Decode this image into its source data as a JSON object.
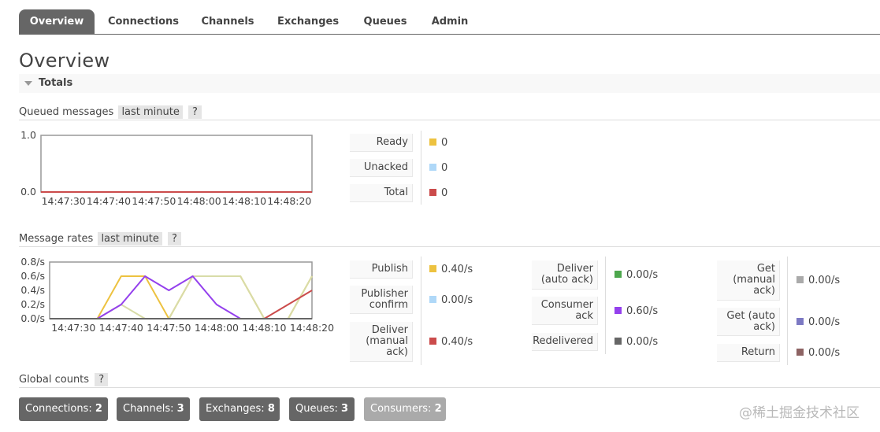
{
  "tabs": [
    "Overview",
    "Connections",
    "Channels",
    "Exchanges",
    "Queues",
    "Admin"
  ],
  "page_title": "Overview",
  "section": {
    "title": "Totals"
  },
  "queued": {
    "heading": "Queued messages",
    "range": "last minute",
    "help": "?",
    "legend": [
      {
        "label": "Ready",
        "value": "0",
        "color": "#edc240"
      },
      {
        "label": "Unacked",
        "value": "0",
        "color": "#afd8f8"
      },
      {
        "label": "Total",
        "value": "0",
        "color": "#cb4b4b"
      }
    ]
  },
  "rates": {
    "heading": "Message rates",
    "range": "last minute",
    "help": "?",
    "legend_col1": [
      {
        "label": "Publish",
        "value": "0.40/s",
        "color": "#edc240"
      },
      {
        "label": "Publisher confirm",
        "value": "0.00/s",
        "color": "#afd8f8"
      },
      {
        "label": "Deliver (manual ack)",
        "value": "0.40/s",
        "color": "#cb4b4b"
      }
    ],
    "legend_col2": [
      {
        "label": "Deliver (auto ack)",
        "value": "0.00/s",
        "color": "#4da74d"
      },
      {
        "label": "Consumer ack",
        "value": "0.60/s",
        "color": "#9440ed"
      },
      {
        "label": "Redelivered",
        "value": "0.00/s",
        "color": "#666666"
      }
    ],
    "legend_col3": [
      {
        "label": "Get (manual ack)",
        "value": "0.00/s",
        "color": "#aaaaaa"
      },
      {
        "label": "Get (auto ack)",
        "value": "0.00/s",
        "color": "#7c79c3"
      },
      {
        "label": "Return",
        "value": "0.00/s",
        "color": "#8d6363"
      }
    ]
  },
  "global": {
    "heading": "Global counts",
    "help": "?",
    "counts": [
      {
        "label": "Connections:",
        "value": "2"
      },
      {
        "label": "Channels:",
        "value": "3"
      },
      {
        "label": "Exchanges:",
        "value": "8"
      },
      {
        "label": "Queues:",
        "value": "3"
      },
      {
        "label": "Consumers:",
        "value": "2"
      }
    ]
  },
  "watermark": "@稀土掘金技术社区",
  "chart_data": [
    {
      "type": "line",
      "name": "queued-messages",
      "x": [
        "14:47:30",
        "14:47:40",
        "14:47:50",
        "14:48:00",
        "14:48:10",
        "14:48:20"
      ],
      "yticks": [
        "1.0",
        "0.0"
      ],
      "ylim": [
        0,
        1
      ],
      "series": [
        {
          "name": "Ready",
          "color": "#edc240",
          "points": [
            [
              -5,
              0
            ],
            [
              55,
              0
            ]
          ]
        },
        {
          "name": "Unacked",
          "color": "#afd8f8",
          "points": [
            [
              -5,
              0
            ],
            [
              55,
              0
            ]
          ]
        },
        {
          "name": "Total",
          "color": "#cb4b4b",
          "points": [
            [
              -5,
              0
            ],
            [
              55,
              0
            ]
          ]
        }
      ],
      "xlim": [
        -5,
        55
      ]
    },
    {
      "type": "line",
      "name": "message-rates",
      "x": [
        "14:47:30",
        "14:47:40",
        "14:47:50",
        "14:48:00",
        "14:48:10",
        "14:48:20"
      ],
      "yticks": [
        "0.8/s",
        "0.6/s",
        "0.4/s",
        "0.2/s",
        "0.0/s"
      ],
      "ylim": [
        0,
        0.8
      ],
      "xlim": [
        -5,
        50
      ],
      "series": [
        {
          "name": "Publish",
          "color": "#edc240",
          "points": [
            [
              -5,
              0
            ],
            [
              5,
              0
            ],
            [
              10,
              0.6
            ],
            [
              15,
              0.6
            ],
            [
              20,
              0
            ],
            [
              25,
              0.6
            ],
            [
              35,
              0.6
            ],
            [
              40,
              0
            ],
            [
              45,
              0
            ],
            [
              50,
              0.6
            ]
          ]
        },
        {
          "name": "Get (manual ack)",
          "color": "#d8dca8",
          "points": [
            [
              -5,
              0
            ],
            [
              5,
              0
            ],
            [
              10,
              0.2
            ],
            [
              15,
              0
            ],
            [
              20,
              0
            ],
            [
              25,
              0.6
            ],
            [
              35,
              0.6
            ],
            [
              40,
              0
            ],
            [
              45,
              0
            ],
            [
              50,
              0.6
            ]
          ]
        },
        {
          "name": "Consumer ack",
          "color": "#9440ed",
          "points": [
            [
              -5,
              0
            ],
            [
              5,
              0
            ],
            [
              10,
              0.2
            ],
            [
              15,
              0.6
            ],
            [
              20,
              0.4
            ],
            [
              25,
              0.6
            ],
            [
              30,
              0.2
            ],
            [
              35,
              0
            ]
          ]
        },
        {
          "name": "Deliver (manual ack)",
          "color": "#cb4b4b",
          "points": [
            [
              40,
              0
            ],
            [
              45,
              0.2
            ],
            [
              50,
              0.4
            ]
          ]
        },
        {
          "name": "Redelivered",
          "color": "#666666",
          "points": [
            [
              -5,
              0
            ],
            [
              50,
              0
            ]
          ]
        }
      ]
    }
  ]
}
